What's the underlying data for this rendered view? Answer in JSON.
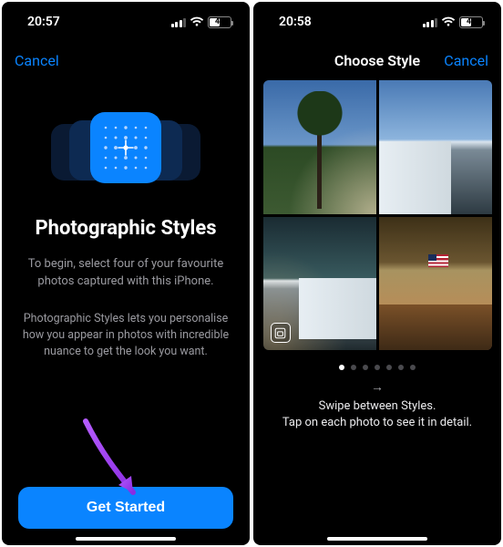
{
  "screen1": {
    "status": {
      "time": "20:57",
      "battery": "45"
    },
    "nav": {
      "cancel": "Cancel"
    },
    "title": "Photographic Styles",
    "intro": "To begin, select four of your favourite photos captured with this iPhone.",
    "desc": "Photographic Styles lets you personalise how you appear in photos with incredible nuance to get the look you want.",
    "cta": "Get Started"
  },
  "screen2": {
    "status": {
      "time": "20:58",
      "battery": "45"
    },
    "nav": {
      "title": "Choose Style",
      "cancel": "Cancel"
    },
    "pager": {
      "count": 7,
      "active": 1
    },
    "hint_line1": "Swipe between Styles.",
    "hint_line2": "Tap on each photo to see it in detail.",
    "swipe_arrow": "→"
  },
  "colors": {
    "accent": "#0a84ff"
  }
}
